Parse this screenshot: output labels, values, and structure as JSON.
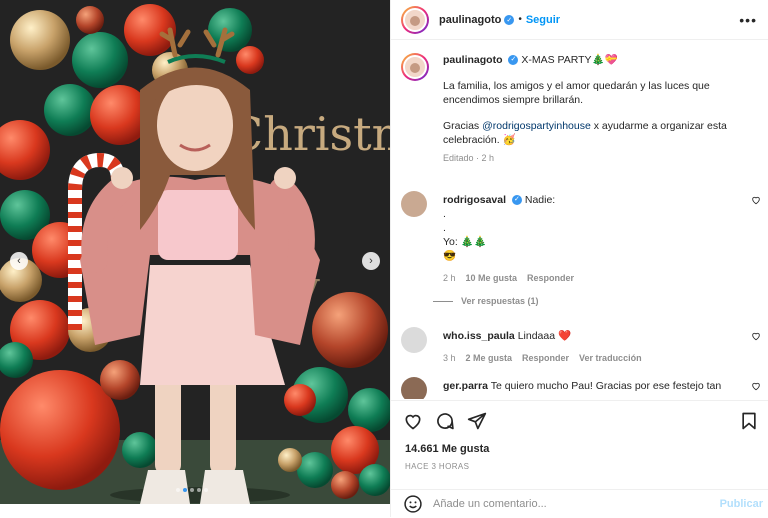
{
  "post": {
    "username": "paulinagoto",
    "follow_label": "Seguir",
    "more_label": "•••"
  },
  "caption": {
    "username": "paulinagoto",
    "title": "X-MAS PARTY🎄💝",
    "paragraph1": "La familia, los amigos y el amor quedarán y las luces que encendimos siempre brillarán.",
    "thanks_prefix": "Gracias",
    "mention": "@rodrigospartyinhouse",
    "thanks_suffix": "x ayudarme a organizar esta celebración. 🥳",
    "edited": "Editado",
    "time": "2 h"
  },
  "comments": [
    {
      "username": "rodrigosaval",
      "lines": [
        "Nadie:",
        ".",
        ".",
        "Yo: 🎄🎄",
        "😎"
      ],
      "time": "2 h",
      "likes": "10 Me gusta",
      "reply": "Responder"
    },
    {
      "username": "who.iss_paula",
      "text": "Lindaaa ❤️",
      "time": "3 h",
      "likes": "2 Me gusta",
      "reply": "Responder",
      "translate": "Ver traducción"
    },
    {
      "username": "ger.parra",
      "text": "Te quiero mucho Pau! Gracias por ese festejo tan"
    }
  ],
  "replies_label": "Ver respuestas (1)",
  "likes_count": "14.661 Me gusta",
  "timestamp": "HACE 3 HORAS",
  "add_comment": {
    "placeholder": "Añade un comentario...",
    "publish": "Publicar"
  },
  "photo_text": {
    "backdrop": "Christmas"
  },
  "colors": {
    "accent": "#0095f6",
    "verified": "#3897f0",
    "muted": "#8e8e8e",
    "heart": "#ed4956"
  }
}
